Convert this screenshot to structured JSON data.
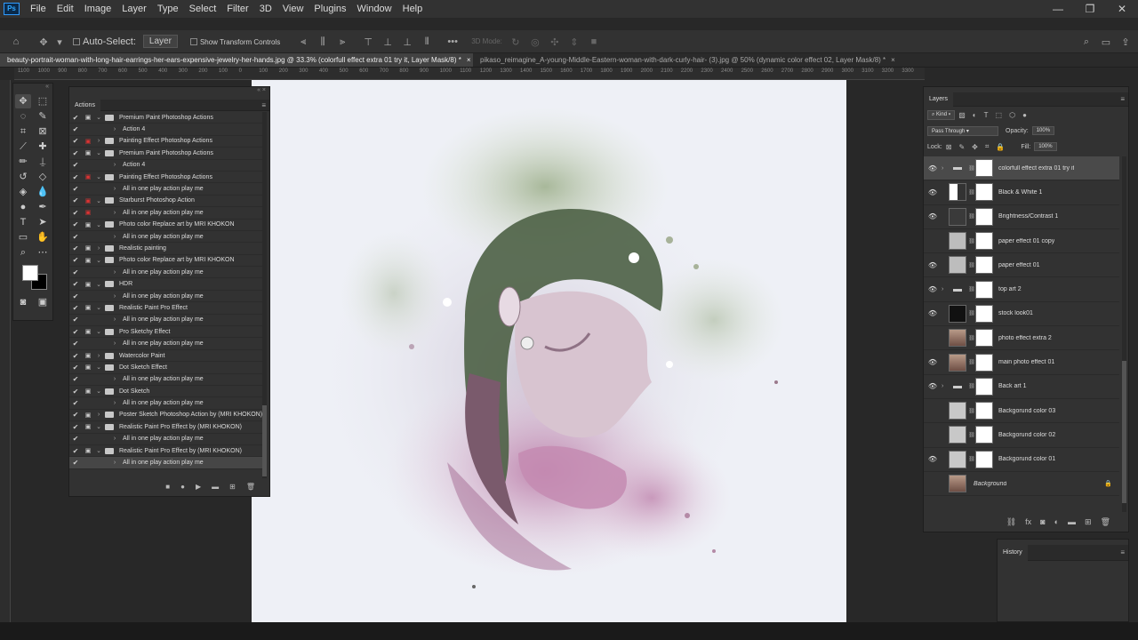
{
  "menu": {
    "logo": "Ps",
    "items": [
      "File",
      "Edit",
      "Image",
      "Layer",
      "Type",
      "Select",
      "Filter",
      "3D",
      "View",
      "Plugins",
      "Window",
      "Help"
    ]
  },
  "options": {
    "auto_select_label": "Auto-Select:",
    "auto_select_value": "Layer",
    "show_transform_label": "Show Transform Controls",
    "mode_3d_label": "3D Mode:"
  },
  "tabs": [
    {
      "label": "beauty-portrait-woman-with-long-hair-earrings-her-ears-expensive-jewelry-her-hands.jpg @ 33.3% (colorfull effect extra 01 try it, Layer Mask/8) *",
      "active": true
    },
    {
      "label": "pikaso_reimagine_A-young-Middle-Eastern-woman-with-dark-curly-hair- (3).jpg @ 50% (dynamic color effect 02, Layer Mask/8) *",
      "active": false
    }
  ],
  "ruler": [
    "1100",
    "1000",
    "900",
    "800",
    "700",
    "600",
    "500",
    "400",
    "300",
    "200",
    "100",
    "0",
    "100",
    "200",
    "300",
    "400",
    "500",
    "600",
    "700",
    "800",
    "900",
    "1000",
    "1100",
    "1200",
    "1300",
    "1400",
    "1500",
    "1600",
    "1700",
    "1800",
    "1900",
    "2000",
    "2100",
    "2200",
    "2300",
    "2400",
    "2500",
    "2600",
    "2700",
    "2800",
    "2900",
    "3000",
    "3100",
    "3200",
    "3300"
  ],
  "actions_panel": {
    "title": "Actions",
    "rows": [
      {
        "label": "Premium Paint Photoshop Actions",
        "type": "set",
        "expanded": true,
        "red": false
      },
      {
        "label": "Action 4",
        "type": "action",
        "red": false
      },
      {
        "label": "Painting Effect Photoshop Actions",
        "type": "set",
        "expanded": false,
        "red": true
      },
      {
        "label": "Premium Paint Photoshop Actions",
        "type": "set",
        "expanded": true,
        "red": false
      },
      {
        "label": "Action 4",
        "type": "action",
        "red": false
      },
      {
        "label": "Painting Effect Photoshop Actions",
        "type": "set",
        "expanded": true,
        "red": true
      },
      {
        "label": "All in one play action play me",
        "type": "action",
        "red": false
      },
      {
        "label": "Starburst Photoshop Action",
        "type": "set",
        "expanded": true,
        "red": true
      },
      {
        "label": "All in one play action play me",
        "type": "action",
        "red": true
      },
      {
        "label": "Photo color Replace art by MRI KHOKON",
        "type": "set",
        "expanded": true,
        "red": false
      },
      {
        "label": "All in one play action play me",
        "type": "action",
        "red": false
      },
      {
        "label": "Realistic painting",
        "type": "set",
        "expanded": false,
        "red": false
      },
      {
        "label": "Photo color Replace art by MRI KHOKON",
        "type": "set",
        "expanded": true,
        "red": false
      },
      {
        "label": "All in one play action play me",
        "type": "action",
        "red": false
      },
      {
        "label": "HDR",
        "type": "set",
        "expanded": true,
        "red": false
      },
      {
        "label": "All in one play action play me",
        "type": "action",
        "red": false
      },
      {
        "label": "Realistic Paint Pro Effect",
        "type": "set",
        "expanded": true,
        "red": false
      },
      {
        "label": "All in one play action play me",
        "type": "action",
        "red": false
      },
      {
        "label": "Pro Sketchy Effect",
        "type": "set",
        "expanded": true,
        "red": false
      },
      {
        "label": "All in one play action play me",
        "type": "action",
        "red": false
      },
      {
        "label": "Watercolor Paint",
        "type": "set",
        "expanded": false,
        "red": false
      },
      {
        "label": "Dot Sketch Effect",
        "type": "set",
        "expanded": true,
        "red": false
      },
      {
        "label": "All in one play action play me",
        "type": "action",
        "red": false
      },
      {
        "label": "Dot Sketch",
        "type": "set",
        "expanded": true,
        "red": false
      },
      {
        "label": "All in one play action play me",
        "type": "action",
        "red": false
      },
      {
        "label": "Poster Sketch Photoshop Action by (MRI KHOKON)",
        "type": "set",
        "expanded": false,
        "red": false
      },
      {
        "label": "Realistic Paint Pro Effect by (MRI KHOKON)",
        "type": "set",
        "expanded": true,
        "red": false
      },
      {
        "label": "All in one play action play me",
        "type": "action",
        "red": false
      },
      {
        "label": "Realistic Paint Pro Effect by (MRI KHOKON)",
        "type": "set",
        "expanded": true,
        "red": false
      },
      {
        "label": "All in one play action play me",
        "type": "action",
        "red": false,
        "selected": true
      }
    ]
  },
  "layers_panel": {
    "title": "Layers",
    "filter_kind": "Kind",
    "blend_mode": "Pass Through",
    "opacity_label": "Opacity:",
    "opacity_value": "100%",
    "lock_label": "Lock:",
    "fill_label": "Fill:",
    "fill_value": "100%",
    "layers": [
      {
        "name": "colorfull effect extra 01 try it",
        "visible": true,
        "group": true,
        "selected": true,
        "thumb": "folder"
      },
      {
        "name": "Black & White 1",
        "visible": true,
        "group": false,
        "thumb": "adjust-bw"
      },
      {
        "name": "Brightness/Contrast 1",
        "visible": true,
        "group": false,
        "thumb": "adjust-sun"
      },
      {
        "name": "paper effect 01 copy",
        "visible": false,
        "group": false,
        "thumb": "paper"
      },
      {
        "name": "paper effect 01",
        "visible": true,
        "group": false,
        "thumb": "paper"
      },
      {
        "name": "top art 2",
        "visible": true,
        "group": true,
        "thumb": "folder"
      },
      {
        "name": "stock look01",
        "visible": true,
        "group": false,
        "thumb": "dark"
      },
      {
        "name": "photo effect extra 2",
        "visible": false,
        "group": false,
        "thumb": "photo"
      },
      {
        "name": "main photo effect 01",
        "visible": true,
        "group": false,
        "thumb": "photo"
      },
      {
        "name": "Back art 1",
        "visible": true,
        "group": true,
        "thumb": "folder"
      },
      {
        "name": "Backgorund color 03",
        "visible": false,
        "group": false,
        "thumb": "grey"
      },
      {
        "name": "Backgorund color 02",
        "visible": false,
        "group": false,
        "thumb": "grey"
      },
      {
        "name": "Backgorund color 01",
        "visible": true,
        "group": false,
        "thumb": "grey"
      },
      {
        "name": "Background",
        "visible": false,
        "group": false,
        "thumb": "photo",
        "locked": true,
        "italic": true
      }
    ]
  },
  "history_panel": {
    "title": "History"
  }
}
